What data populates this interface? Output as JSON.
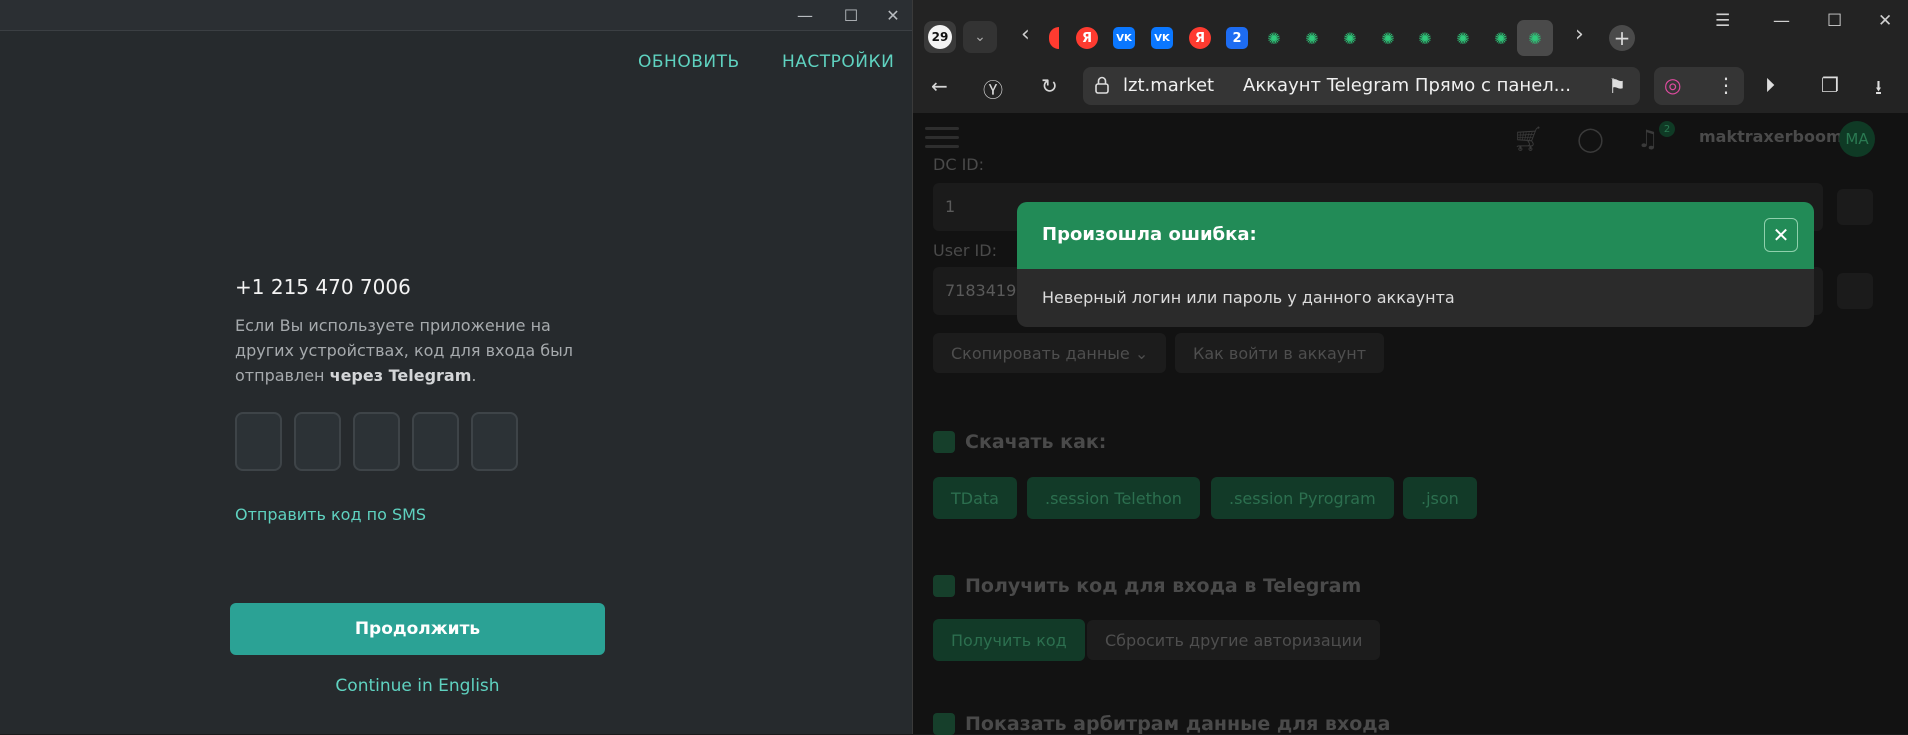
{
  "telegram": {
    "top_buttons": {
      "update": "ОБНОВИТЬ",
      "settings": "НАСТРОЙКИ"
    },
    "phone": "+1 215 470 7006",
    "info_text": "Если Вы используете приложение на других устройствах, код для входа был отправлен",
    "info_bold": "через Telegram",
    "info_end": ".",
    "code_cells_count": 5,
    "sms_link": "Отправить код по SMS",
    "continue_button": "Продолжить",
    "english_link": "Continue in English"
  },
  "browser": {
    "tab_count": "29",
    "tabs": [
      {
        "icon": "yandex-icon",
        "text": "Я"
      },
      {
        "icon": "vk-icon",
        "text": "VK"
      },
      {
        "icon": "vk-icon",
        "text": "VK"
      },
      {
        "icon": "yandex-icon",
        "text": "Я"
      },
      {
        "icon": "number-tab-icon",
        "text": "2"
      }
    ],
    "address": {
      "domain": "lzt.market",
      "title": "Аккаунт Telegram Прямо с панел..."
    },
    "header": {
      "username": "maktraxerboom",
      "avatar": "MA",
      "notification_count": "2"
    },
    "page": {
      "dc_id_label": "DC ID:",
      "dc_id_value": "1",
      "user_id_label": "User ID:",
      "user_id_value": "71834195",
      "copy_data_button": "Скопировать данные",
      "how_to_login_button": "Как войти в аккаунт",
      "download_section": "Скачать как:",
      "download_buttons": [
        "TData",
        ".session Telethon",
        ".session Pyrogram",
        ".json"
      ],
      "get_code_section": "Получить код для входа в Telegram",
      "get_code_button": "Получить код",
      "reset_button": "Сбросить другие авторизации",
      "show_section": "Показать арбитрам данные для входа"
    },
    "modal": {
      "title": "Произошла ошибка:",
      "message": "Неверный логин или пароль у данного аккаунта"
    }
  },
  "colors": {
    "telegram_accent": "#2ba295",
    "telegram_link": "#5fd2c0",
    "modal_header": "#228b57"
  }
}
